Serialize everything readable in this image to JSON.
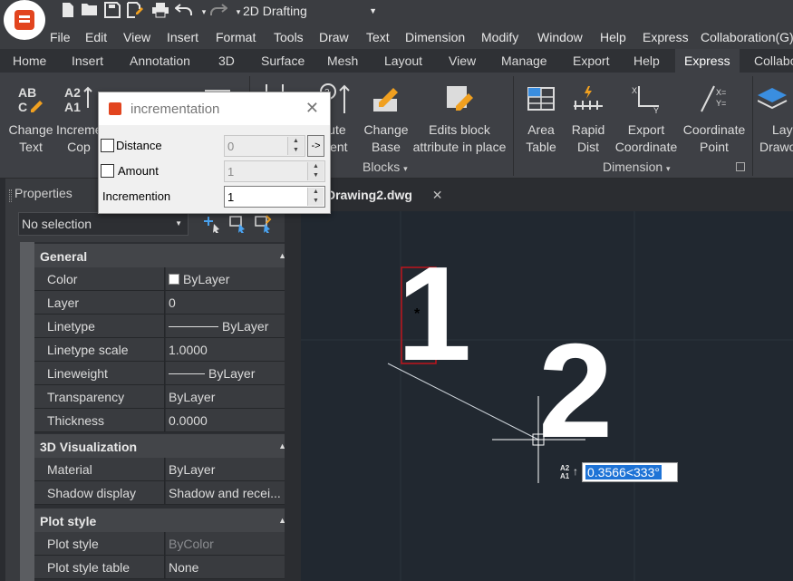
{
  "app": {
    "workspace": "2D Drafting"
  },
  "colors": {
    "accent_brand": "#e2451f",
    "canvas_bg": "#212830",
    "selection_blue": "#1e73d6",
    "selection_box_red": "#c0141c"
  },
  "quick_access": [
    "new-icon",
    "open-icon",
    "save-icon",
    "save-as-icon",
    "print-icon",
    "undo-icon",
    "redo-icon"
  ],
  "menubar": {
    "items": [
      "File",
      "Edit",
      "View",
      "Insert",
      "Format",
      "Tools",
      "Draw",
      "Text",
      "Dimension",
      "Modify",
      "Window",
      "Help",
      "Express",
      "Collaboration(G)"
    ]
  },
  "ribbon_tabs": {
    "items": [
      "Home",
      "Insert",
      "Annotation",
      "3D",
      "Surface",
      "Mesh",
      "Layout",
      "View",
      "Manage",
      "Export",
      "Help",
      "Express",
      "Collabo"
    ],
    "active": "Express"
  },
  "ribbon": {
    "change_text": {
      "line1": "Change",
      "line2": "Text"
    },
    "incremental_copy": {
      "line1": "Increme",
      "line2": "Cop"
    },
    "attribute_alignment": {
      "line1": "oute",
      "line2": "ment"
    },
    "change_base": {
      "line1": "Change",
      "line2": "Base"
    },
    "edits_block": {
      "line1": "Edits block",
      "line2": "attribute in place"
    },
    "area_table": {
      "line1": "Area",
      "line2": "Table"
    },
    "rapid_dist": {
      "line1": "Rapid",
      "line2": "Dist"
    },
    "export_coordinate": {
      "line1": "Export",
      "line2": "Coordinate"
    },
    "coordinate_point": {
      "line1": "Coordinate",
      "line2": "Point"
    },
    "layer_draw": {
      "line1": "Lay",
      "line2": "Drawo"
    },
    "panel_blocks": "Blocks",
    "panel_dimension": "Dimension"
  },
  "properties": {
    "header": "Properties",
    "selection": "No selection",
    "sections": {
      "general": "General",
      "visualization": "3D Visualization",
      "plot": "Plot style"
    },
    "general_rows": [
      {
        "key": "Color",
        "value": "ByLayer"
      },
      {
        "key": "Layer",
        "value": "0"
      },
      {
        "key": "Linetype",
        "value": "ByLayer"
      },
      {
        "key": "Linetype scale",
        "value": "1.0000"
      },
      {
        "key": "Lineweight",
        "value": "ByLayer"
      },
      {
        "key": "Transparency",
        "value": "ByLayer"
      },
      {
        "key": "Thickness",
        "value": "0.0000"
      }
    ],
    "viz_rows": [
      {
        "key": "Material",
        "value": "ByLayer"
      },
      {
        "key": "Shadow display",
        "value": "Shadow and recei..."
      }
    ],
    "plot_rows": [
      {
        "key": "Plot style",
        "value": "ByColor"
      },
      {
        "key": "Plot style table",
        "value": "None"
      }
    ]
  },
  "document": {
    "tab": "Drawing2.dwg",
    "close": "✕"
  },
  "canvas": {
    "text1": "1",
    "text2": "2",
    "grip": "*",
    "input_value": "0.3566<333°",
    "sort_icon_top": "A2",
    "sort_icon_bottom": "A1"
  },
  "dialog": {
    "title": "incrementation",
    "close": "✕",
    "distance_label": "Distance",
    "distance_value": "0",
    "distance_checked": false,
    "pick": "->",
    "amount_label": "Amount",
    "amount_value": "1",
    "amount_checked": false,
    "incremention_label": "Incremention",
    "incremention_value": "1"
  }
}
